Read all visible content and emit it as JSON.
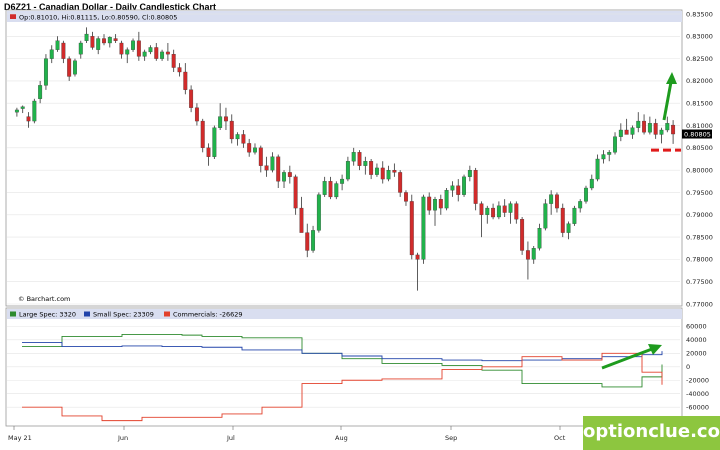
{
  "chart_data": [
    {
      "type": "candlestick",
      "title": "D6Z21 - Canadian Dollar - Daily Candlestick Chart",
      "ohlc_label": "Op:0.81010, Hi:0.81115, Lo:0.80590, Cl:0.80805",
      "last_price_label": "0.80805",
      "watermark": "© Barchart.com",
      "y_ticks": [
        "0.83500",
        "0.83000",
        "0.82500",
        "0.82000",
        "0.81500",
        "0.81000",
        "0.80500",
        "0.80000",
        "0.79500",
        "0.79000",
        "0.78500",
        "0.78000",
        "0.77500",
        "0.77000"
      ],
      "ylim": [
        0.77,
        0.835
      ],
      "x_ticks": [
        "May 21",
        "Jun",
        "Jul",
        "Aug",
        "Sep",
        "Oct"
      ],
      "colors": {
        "up": "#21b24b",
        "down": "#d12b2b"
      },
      "candles": [
        [
          0.813,
          0.814,
          0.812,
          0.8135
        ],
        [
          0.8138,
          0.8145,
          0.8128,
          0.8142
        ],
        [
          0.812,
          0.813,
          0.8095,
          0.811
        ],
        [
          0.811,
          0.816,
          0.8105,
          0.8155
        ],
        [
          0.816,
          0.82,
          0.815,
          0.819
        ],
        [
          0.819,
          0.826,
          0.818,
          0.825
        ],
        [
          0.825,
          0.828,
          0.824,
          0.827
        ],
        [
          0.827,
          0.83,
          0.8265,
          0.829
        ],
        [
          0.8285,
          0.829,
          0.824,
          0.825
        ],
        [
          0.825,
          0.8255,
          0.82,
          0.821
        ],
        [
          0.8215,
          0.825,
          0.821,
          0.8245
        ],
        [
          0.826,
          0.829,
          0.825,
          0.8285
        ],
        [
          0.829,
          0.832,
          0.8285,
          0.8305
        ],
        [
          0.83,
          0.831,
          0.827,
          0.8275
        ],
        [
          0.827,
          0.83,
          0.826,
          0.8295
        ],
        [
          0.8295,
          0.8305,
          0.828,
          0.8285
        ],
        [
          0.8285,
          0.83,
          0.8275,
          0.8298
        ],
        [
          0.8295,
          0.8305,
          0.8285,
          0.829
        ],
        [
          0.8285,
          0.829,
          0.825,
          0.826
        ],
        [
          0.826,
          0.8275,
          0.824,
          0.827
        ],
        [
          0.827,
          0.8295,
          0.8265,
          0.829
        ],
        [
          0.829,
          0.831,
          0.8245,
          0.8255
        ],
        [
          0.8255,
          0.827,
          0.8245,
          0.8265
        ],
        [
          0.8265,
          0.828,
          0.826,
          0.8275
        ],
        [
          0.8275,
          0.8285,
          0.8245,
          0.825
        ],
        [
          0.825,
          0.827,
          0.8245,
          0.8265
        ],
        [
          0.8265,
          0.8285,
          0.8245,
          0.826
        ],
        [
          0.826,
          0.827,
          0.822,
          0.823
        ],
        [
          0.823,
          0.824,
          0.821,
          0.822
        ],
        [
          0.822,
          0.824,
          0.817,
          0.818
        ],
        [
          0.818,
          0.819,
          0.813,
          0.814
        ],
        [
          0.814,
          0.815,
          0.81,
          0.811
        ],
        [
          0.811,
          0.8115,
          0.804,
          0.805
        ],
        [
          0.805,
          0.806,
          0.801,
          0.803
        ],
        [
          0.803,
          0.81,
          0.8025,
          0.8095
        ],
        [
          0.8095,
          0.815,
          0.809,
          0.812
        ],
        [
          0.812,
          0.814,
          0.809,
          0.811
        ],
        [
          0.811,
          0.8125,
          0.806,
          0.807
        ],
        [
          0.807,
          0.8085,
          0.8055,
          0.808
        ],
        [
          0.808,
          0.809,
          0.805,
          0.806
        ],
        [
          0.806,
          0.807,
          0.803,
          0.804
        ],
        [
          0.804,
          0.806,
          0.8035,
          0.805
        ],
        [
          0.805,
          0.8055,
          0.7995,
          0.801
        ],
        [
          0.801,
          0.803,
          0.7985,
          0.8
        ],
        [
          0.8,
          0.804,
          0.7995,
          0.803
        ],
        [
          0.803,
          0.8035,
          0.796,
          0.7975
        ],
        [
          0.7975,
          0.8,
          0.796,
          0.7995
        ],
        [
          0.7995,
          0.801,
          0.797,
          0.7985
        ],
        [
          0.7985,
          0.799,
          0.79,
          0.7915
        ],
        [
          0.7915,
          0.794,
          0.7875,
          0.786
        ],
        [
          0.786,
          0.788,
          0.7805,
          0.782
        ],
        [
          0.782,
          0.7875,
          0.7815,
          0.7865
        ],
        [
          0.7865,
          0.795,
          0.786,
          0.7945
        ],
        [
          0.7945,
          0.7985,
          0.794,
          0.7975
        ],
        [
          0.7975,
          0.7985,
          0.7935,
          0.794
        ],
        [
          0.794,
          0.7975,
          0.7935,
          0.797
        ],
        [
          0.797,
          0.799,
          0.7955,
          0.798
        ],
        [
          0.798,
          0.803,
          0.7975,
          0.802
        ],
        [
          0.802,
          0.805,
          0.801,
          0.804
        ],
        [
          0.804,
          0.8045,
          0.8,
          0.801
        ],
        [
          0.801,
          0.803,
          0.799,
          0.802
        ],
        [
          0.802,
          0.8025,
          0.798,
          0.799
        ],
        [
          0.799,
          0.8015,
          0.7985,
          0.8005
        ],
        [
          0.8005,
          0.802,
          0.797,
          0.798
        ],
        [
          0.798,
          0.801,
          0.7975,
          0.8
        ],
        [
          0.8,
          0.8015,
          0.7985,
          0.7995
        ],
        [
          0.7995,
          0.8,
          0.794,
          0.795
        ],
        [
          0.795,
          0.7955,
          0.792,
          0.793
        ],
        [
          0.793,
          0.7945,
          0.78,
          0.781
        ],
        [
          0.781,
          0.7815,
          0.773,
          0.78
        ],
        [
          0.78,
          0.7945,
          0.779,
          0.794
        ],
        [
          0.794,
          0.795,
          0.79,
          0.791
        ],
        [
          0.791,
          0.794,
          0.7875,
          0.7935
        ],
        [
          0.7935,
          0.7945,
          0.79,
          0.7915
        ],
        [
          0.7915,
          0.796,
          0.791,
          0.7955
        ],
        [
          0.7955,
          0.7975,
          0.794,
          0.7965
        ],
        [
          0.7965,
          0.798,
          0.793,
          0.7945
        ],
        [
          0.7945,
          0.799,
          0.794,
          0.7985
        ],
        [
          0.7985,
          0.801,
          0.7975,
          0.8
        ],
        [
          0.8,
          0.8005,
          0.791,
          0.7925
        ],
        [
          0.7925,
          0.793,
          0.785,
          0.79
        ],
        [
          0.79,
          0.792,
          0.788,
          0.7915
        ],
        [
          0.7915,
          0.7925,
          0.789,
          0.7895
        ],
        [
          0.7895,
          0.793,
          0.789,
          0.792
        ],
        [
          0.792,
          0.7935,
          0.7895,
          0.7905
        ],
        [
          0.7905,
          0.793,
          0.788,
          0.7925
        ],
        [
          0.7925,
          0.793,
          0.788,
          0.789
        ],
        [
          0.789,
          0.7895,
          0.781,
          0.782
        ],
        [
          0.782,
          0.784,
          0.7755,
          0.78
        ],
        [
          0.78,
          0.783,
          0.779,
          0.7825
        ],
        [
          0.7825,
          0.788,
          0.782,
          0.787
        ],
        [
          0.787,
          0.7935,
          0.7865,
          0.7925
        ],
        [
          0.7925,
          0.7955,
          0.79,
          0.7945
        ],
        [
          0.7945,
          0.795,
          0.7905,
          0.7915
        ],
        [
          0.7915,
          0.7925,
          0.785,
          0.786
        ],
        [
          0.786,
          0.7885,
          0.7845,
          0.788
        ],
        [
          0.788,
          0.792,
          0.7875,
          0.7915
        ],
        [
          0.7915,
          0.7935,
          0.7905,
          0.793
        ],
        [
          0.793,
          0.7965,
          0.7925,
          0.796
        ],
        [
          0.796,
          0.799,
          0.7955,
          0.798
        ],
        [
          0.798,
          0.8035,
          0.7975,
          0.8025
        ],
        [
          0.8025,
          0.8045,
          0.8015,
          0.8035
        ],
        [
          0.8035,
          0.8045,
          0.802,
          0.804
        ],
        [
          0.804,
          0.8085,
          0.8035,
          0.8075
        ],
        [
          0.8075,
          0.8105,
          0.8065,
          0.809
        ],
        [
          0.809,
          0.8115,
          0.808,
          0.808
        ],
        [
          0.808,
          0.81,
          0.807,
          0.8095
        ],
        [
          0.8095,
          0.813,
          0.8085,
          0.811
        ],
        [
          0.811,
          0.8125,
          0.808,
          0.8085
        ],
        [
          0.8085,
          0.812,
          0.808,
          0.8105
        ],
        [
          0.8105,
          0.8115,
          0.807,
          0.808
        ],
        [
          0.808,
          0.8095,
          0.806,
          0.809
        ],
        [
          0.809,
          0.812,
          0.8085,
          0.8105
        ],
        [
          0.8101,
          0.8112,
          0.8059,
          0.8081
        ]
      ],
      "forecast": {
        "arrow": "up",
        "dashed_level": 0.8045
      }
    },
    {
      "type": "line",
      "title": "",
      "series": [
        {
          "name": "Large Spec: 3320",
          "color": "#2e8b2e",
          "values": [
            30000,
            30000,
            45000,
            45000,
            45000,
            48000,
            48000,
            48000,
            47000,
            45000,
            45000,
            43000,
            43000,
            43000,
            20000,
            20000,
            12000,
            12000,
            5000,
            5000,
            5000,
            2000,
            2000,
            -5000,
            -5000,
            -25000,
            -25000,
            -25000,
            -25000,
            -30000,
            -30000,
            -15000,
            3320
          ]
        },
        {
          "name": "Small Spec: 23309",
          "color": "#2244aa",
          "values": [
            36000,
            36000,
            30000,
            30000,
            30000,
            31000,
            31000,
            30000,
            30000,
            29000,
            29000,
            25000,
            25000,
            25000,
            20000,
            20000,
            16000,
            16000,
            12000,
            12000,
            12000,
            10000,
            10000,
            9000,
            9000,
            10000,
            10000,
            12000,
            12000,
            15000,
            15000,
            18000,
            23309
          ]
        },
        {
          "name": "Commercials: -26629",
          "color": "#e2402b",
          "values": [
            -60000,
            -60000,
            -73000,
            -73000,
            -80000,
            -80000,
            -75000,
            -75000,
            -75000,
            -75000,
            -70000,
            -70000,
            -60000,
            -60000,
            -25000,
            -25000,
            -20000,
            -20000,
            -18000,
            -18000,
            -18000,
            -4000,
            -4000,
            0,
            0,
            15000,
            15000,
            10000,
            10000,
            20000,
            20000,
            -8000,
            -26629
          ]
        }
      ],
      "y_ticks": [
        "60000",
        "40000",
        "20000",
        "0",
        "-20000",
        "-40000",
        "-60000"
      ],
      "ylim": [
        -85000,
        68000
      ]
    }
  ],
  "branding": {
    "text": "optionclue.com",
    "color": "#8dc63f"
  }
}
